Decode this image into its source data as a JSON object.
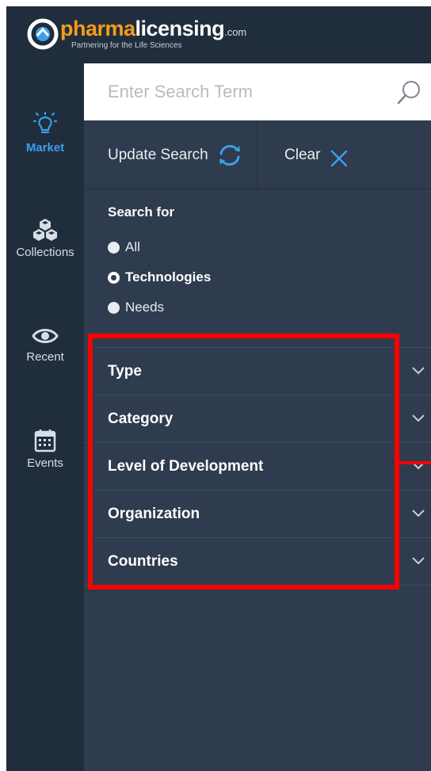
{
  "brand": {
    "logo_pharma": "pharma",
    "logo_licensing": "licensing",
    "logo_com": ".com",
    "tagline": "Partnering for the Life Sciences",
    "colors": {
      "orange": "#f59c1a",
      "accent_blue": "#3aa0e8",
      "highlight_red": "#ff0000"
    }
  },
  "sidebar": {
    "items": [
      {
        "label": "Market",
        "icon": "lightbulb-icon",
        "active": true
      },
      {
        "label": "Collections",
        "icon": "cubes-icon",
        "active": false
      },
      {
        "label": "Recent",
        "icon": "eye-icon",
        "active": false
      },
      {
        "label": "Events",
        "icon": "calendar-icon",
        "active": false
      }
    ]
  },
  "search": {
    "placeholder": "Enter Search Term",
    "value": "",
    "icon": "search-icon"
  },
  "actions": {
    "update_label": "Update Search",
    "update_icon": "refresh-icon",
    "clear_label": "Clear",
    "clear_icon": "close-icon"
  },
  "search_for": {
    "heading": "Search for",
    "options": [
      {
        "label": "All",
        "checked": false
      },
      {
        "label": "Technologies",
        "checked": true
      },
      {
        "label": "Needs",
        "checked": false
      }
    ]
  },
  "filters": [
    {
      "label": "Type",
      "icon": "chevron-down-icon"
    },
    {
      "label": "Category",
      "icon": "chevron-down-icon"
    },
    {
      "label": "Level of Development",
      "icon": "chevron-down-icon"
    },
    {
      "label": "Organization",
      "icon": "chevron-down-icon"
    },
    {
      "label": "Countries",
      "icon": "chevron-down-icon"
    }
  ]
}
